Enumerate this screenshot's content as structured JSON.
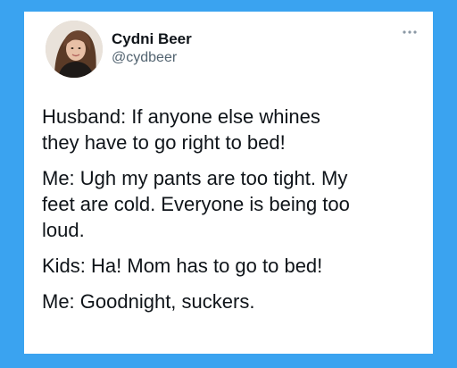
{
  "author": {
    "display_name": "Cydni Beer",
    "handle": "@cydbeer"
  },
  "tweet": {
    "lines": [
      [
        "Husband: If anyone else whines",
        "they have to go right to bed!"
      ],
      [
        "Me: Ugh my pants are too tight. My",
        "feet are cold. Everyone is being too",
        "loud."
      ],
      [
        "Kids: Ha! Mom has to go to bed!"
      ],
      [
        "Me: Goodnight, suckers."
      ]
    ]
  },
  "icons": {
    "more": "more-options-icon",
    "avatar": "profile-photo"
  },
  "colors": {
    "background": "#3aa3f0",
    "card": "#ffffff",
    "text_primary": "#0f1419",
    "text_secondary": "#536471"
  }
}
